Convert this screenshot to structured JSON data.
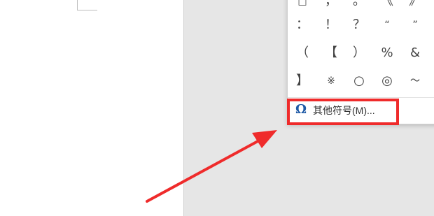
{
  "symbol_panel": {
    "rows": [
      [
        "□",
        "，",
        "。",
        "《",
        "》"
      ],
      [
        "：",
        "！",
        "？",
        "“",
        "”"
      ],
      [
        "（",
        "【",
        "）",
        "%",
        "&"
      ],
      [
        "】",
        "※",
        "○",
        "◎",
        "～"
      ]
    ],
    "more_symbols_label": "其他符号(M)..."
  },
  "colors": {
    "highlight": "#ef2b2b",
    "arrow": "#ef2b2b",
    "omega_icon": "#1f5aa6"
  }
}
